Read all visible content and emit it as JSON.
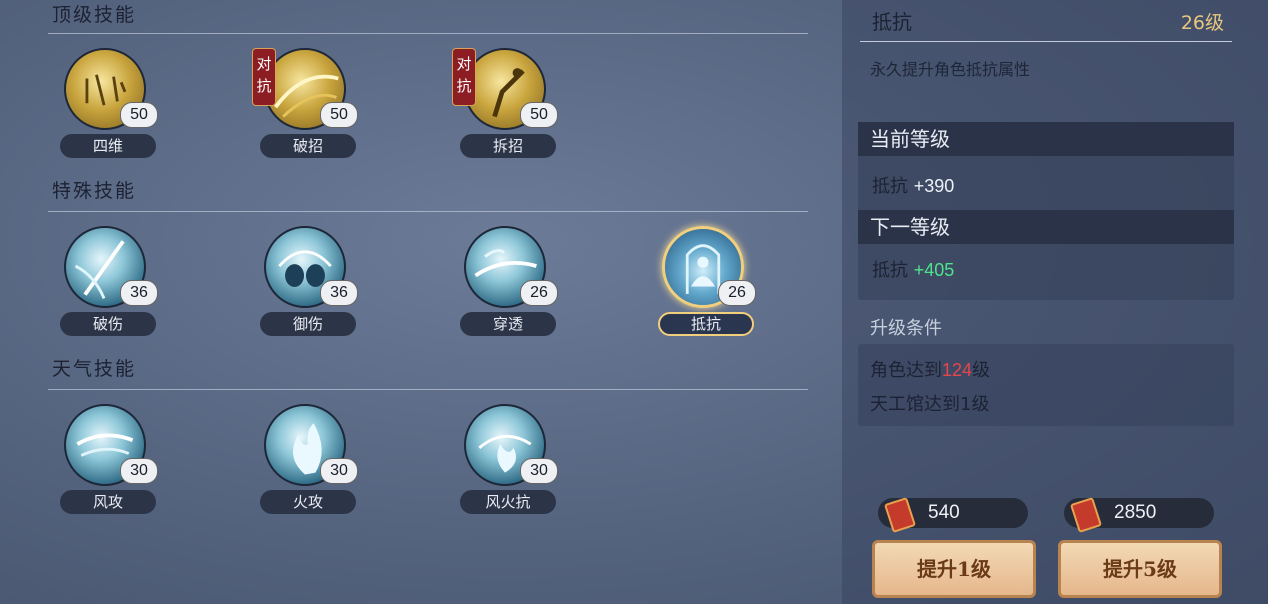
{
  "sections": [
    {
      "title": "顶级技能"
    },
    {
      "title": "特殊技能"
    },
    {
      "title": "天气技能"
    }
  ],
  "skills": {
    "top": [
      {
        "name": "四维",
        "level": "50",
        "badge": ""
      },
      {
        "name": "破招",
        "level": "50",
        "badge": "对抗"
      },
      {
        "name": "拆招",
        "level": "50",
        "badge": "对抗"
      }
    ],
    "special": [
      {
        "name": "破伤",
        "level": "36"
      },
      {
        "name": "御伤",
        "level": "36"
      },
      {
        "name": "穿透",
        "level": "26"
      },
      {
        "name": "抵抗",
        "level": "26",
        "selected": true
      }
    ],
    "weather": [
      {
        "name": "风攻",
        "level": "30"
      },
      {
        "name": "火攻",
        "level": "30"
      },
      {
        "name": "风火抗",
        "level": "30"
      }
    ]
  },
  "badge_text": {
    "line1": "对",
    "line2": "抗"
  },
  "detail": {
    "title": "抵抗",
    "level": "26级",
    "description": "永久提升角色抵抗属性",
    "current_label": "当前等级",
    "current_stat": "抵抗",
    "current_value": "+390",
    "next_label": "下一等级",
    "next_stat": "抵抗",
    "next_value": "+405",
    "condition_title": "升级条件",
    "cond1_prefix": "角色达到",
    "cond1_value": "124",
    "cond1_suffix": "级",
    "cond2": "天工馆达到1级"
  },
  "costs": {
    "cost1": "540",
    "cost2": "2850"
  },
  "buttons": {
    "up1": "提升1级",
    "up5": "提升5级"
  },
  "colors": {
    "accent_gold": "#e7c77d",
    "next_value_green": "#4fe38a",
    "requirement_red": "#e5464b"
  }
}
